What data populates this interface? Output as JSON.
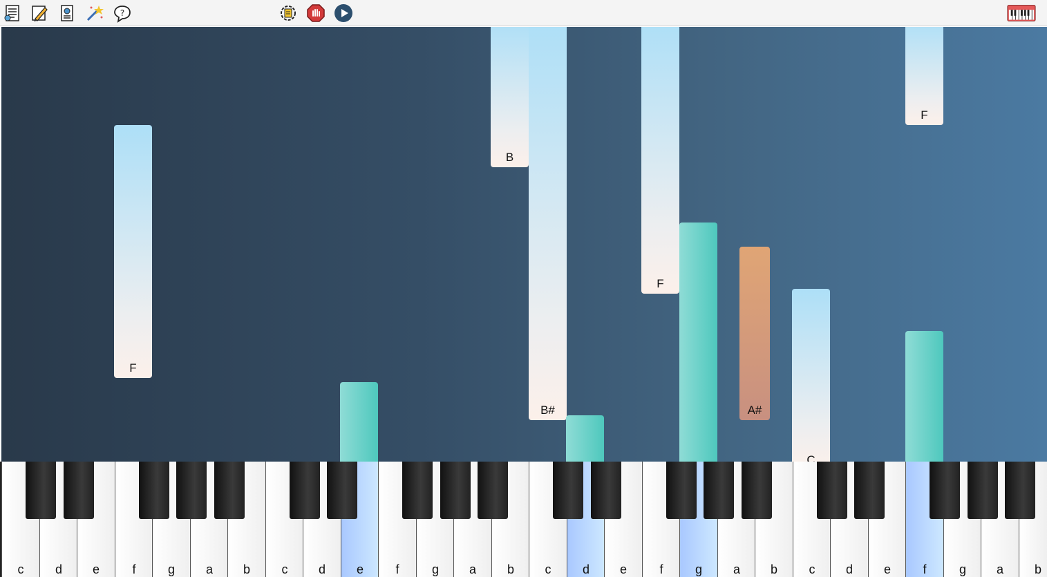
{
  "toolbar": {
    "left_icons": [
      "document-list-icon",
      "pencil-icon",
      "document-settings-icon",
      "magic-wand-icon",
      "help-icon"
    ],
    "center_icons": [
      "refresh-icon",
      "stop-icon",
      "play-icon"
    ],
    "right_icon": "piano-keyboard-icon"
  },
  "colors": {
    "accent_teal": "#4ec8bd",
    "note_orange": "#d99a7b",
    "note_light_top": "#addff7",
    "active_key_blue": "#b9d8ff"
  },
  "notes": [
    {
      "label": "F",
      "kind": "light"
    },
    {
      "label": "",
      "kind": "teal"
    },
    {
      "label": "B",
      "kind": "light"
    },
    {
      "label": "B#",
      "kind": "light"
    },
    {
      "label": "",
      "kind": "teal"
    },
    {
      "label": "F",
      "kind": "light"
    },
    {
      "label": "",
      "kind": "teal"
    },
    {
      "label": "A#",
      "kind": "orange"
    },
    {
      "label": "C",
      "kind": "light"
    },
    {
      "label": "F",
      "kind": "light"
    },
    {
      "label": "",
      "kind": "teal"
    }
  ],
  "keyboard": {
    "white_keys": [
      "c",
      "d",
      "e",
      "f",
      "g",
      "a",
      "b",
      "c",
      "d",
      "e",
      "f",
      "g",
      "a",
      "b",
      "c",
      "d",
      "e",
      "f",
      "g",
      "a",
      "b",
      "c",
      "d",
      "e",
      "f",
      "g",
      "a",
      "b"
    ],
    "active_keys": [
      "e",
      "d",
      "g",
      "f"
    ]
  }
}
